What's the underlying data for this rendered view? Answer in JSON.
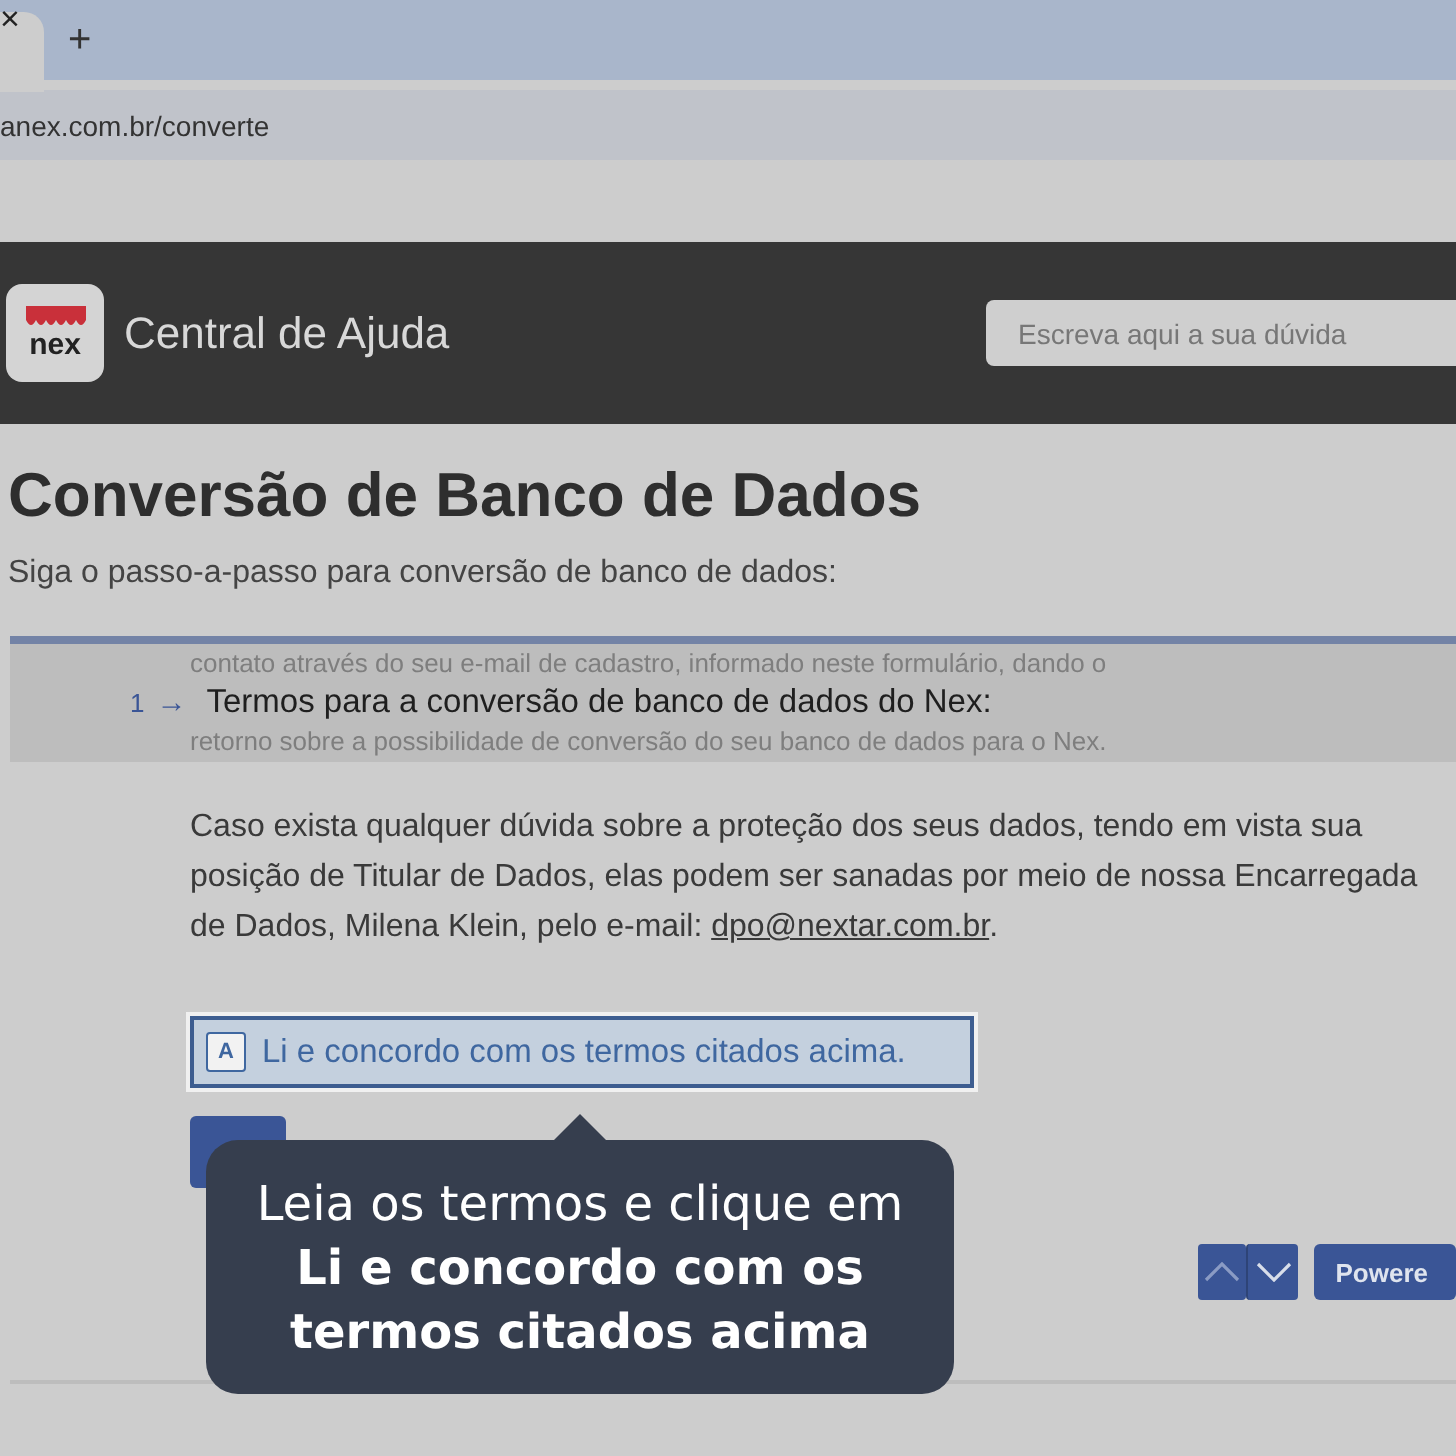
{
  "browser": {
    "close_tab": "×",
    "new_tab": "+",
    "address": "anex.com.br/converte"
  },
  "header": {
    "logo_text": "nex",
    "title": "Central de Ajuda",
    "search": {
      "placeholder": "Escreva aqui a sua dúvida"
    }
  },
  "page": {
    "title": "Conversão de Banco de Dados",
    "subtitle": "Siga o passo-a-passo para conversão de banco de dados:"
  },
  "form": {
    "question": {
      "number": "1",
      "arrow": "→",
      "text": "Termos para a conversão de banco de dados do Nex:"
    },
    "paragraph": "Caso exista qualquer dúvida sobre a proteção dos seus dados, tendo em vista sua posição de Titular de Dados, elas podem ser sanadas por meio de nossa Encarregada de Dados, Milena Klein, pelo e-mail: ",
    "link": "dpo@nextar.com.br",
    "paragraph_end": ".",
    "behind_text": [
      "contato através do seu e-mail de cadastro, informado neste formulário, dando o",
      "retorno sobre a possibilidade de conversão do seu banco de dados para o Nex."
    ],
    "choices": [
      {
        "key": "A",
        "label": "Li e concordo com os termos citados acima.",
        "selected": true
      }
    ],
    "powered": "Powere"
  },
  "tooltip": {
    "text": "Leia os termos e clique em **Li e concordo com os termos citados acima**"
  }
}
